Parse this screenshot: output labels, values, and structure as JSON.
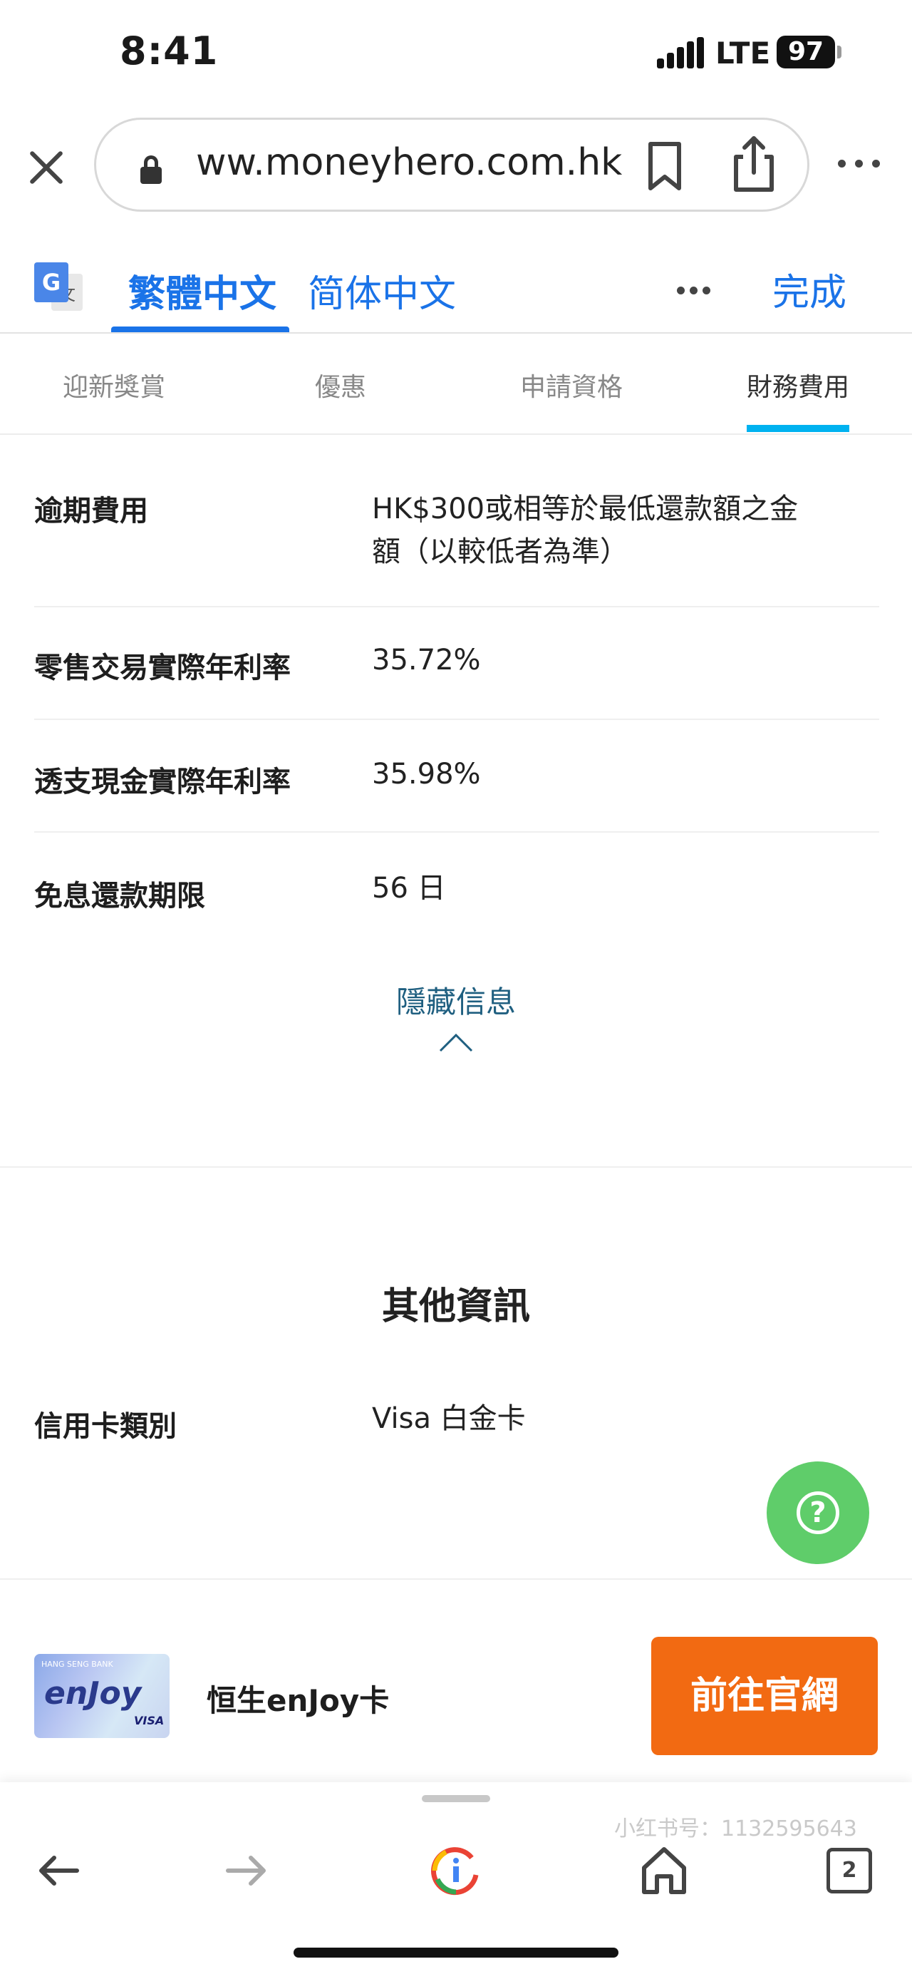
{
  "status_bar": {
    "time": "8:41",
    "network": "LTE",
    "battery": "97"
  },
  "browser": {
    "url": "ww.moneyhero.com.hk"
  },
  "translate_bar": {
    "traditional": "繁體中文",
    "simplified": "简体中文",
    "done": "完成"
  },
  "section_tabs": [
    "迎新獎賞",
    "優惠",
    "申請資格",
    "財務費用"
  ],
  "fees": [
    {
      "label": "逾期費用",
      "value": "HK$300或相等於最低還款額之金額（以較低者為準）"
    },
    {
      "label": "零售交易實際年利率",
      "value": "35.72%"
    },
    {
      "label": "透支現金實際年利率",
      "value": "35.98%"
    },
    {
      "label": "免息還款期限",
      "value": "56 日"
    }
  ],
  "hide_info": "隱藏信息",
  "other_info": {
    "title": "其他資訊",
    "rows": [
      {
        "label": "信用卡類別",
        "value": "Visa 白金卡"
      }
    ]
  },
  "help_button": "?",
  "product": {
    "card_bank": "HANG SENG BANK",
    "card_logo": "enJoy",
    "card_network": "VISA",
    "name": "恒生enJoy卡",
    "cta": "前往官網"
  },
  "toolbar": {
    "tabs_count": "2"
  },
  "watermark": "小红书号：1132595643",
  "colors": {
    "accent_blue": "#1a73e8",
    "tab_indicator": "#00b2f0",
    "cta_orange": "#f26a12",
    "help_green": "#5fcd6a"
  }
}
